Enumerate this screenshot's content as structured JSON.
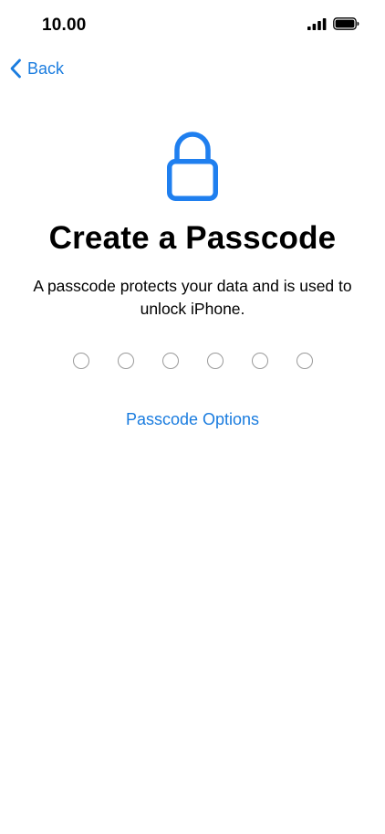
{
  "status_bar": {
    "time": "10.00",
    "icons": [
      "cellular-signal-icon",
      "battery-icon"
    ]
  },
  "nav": {
    "back_label": "Back"
  },
  "main": {
    "icon": "lock-icon",
    "title": "Create a Passcode",
    "description": "A passcode protects your data and is used to unlock iPhone.",
    "passcode_length": 6,
    "options_label": "Passcode Options"
  },
  "colors": {
    "accent": "#1a7cdf",
    "lock": "#1f7fef",
    "dot_border": "#9a9a9a",
    "text": "#000000",
    "background": "#ffffff"
  }
}
